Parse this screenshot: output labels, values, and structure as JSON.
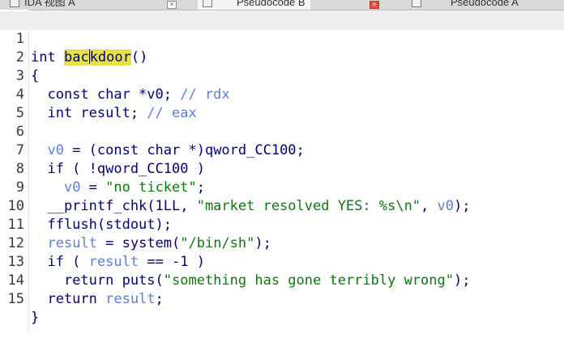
{
  "tabs": [
    {
      "label": "IDA 视图 A",
      "close": "×"
    },
    {
      "label": "Pseudocode B",
      "close": "×"
    },
    {
      "label": "Pseudocode A",
      "close": "×"
    }
  ],
  "code": {
    "line_numbers": [
      "1",
      "2",
      "3",
      "4",
      "5",
      "6",
      "7",
      "8",
      "9",
      "10",
      "11",
      "12",
      "13",
      "14",
      "15"
    ],
    "l1": {
      "t1": "int ",
      "fn_a": "bac",
      "fn_b": "kdoor",
      "t2": "()"
    },
    "l2": {
      "t1": "{"
    },
    "l3": {
      "t1": "  const char *v0; ",
      "c": "// rdx"
    },
    "l4": {
      "t1": "  int result; ",
      "c": "// eax"
    },
    "l5": {
      "t1": ""
    },
    "l6": {
      "v": "v0",
      "t1": " = (const char *)qword_CC100;"
    },
    "l7": {
      "t1": "  if ( !qword_CC100 )"
    },
    "l8": {
      "v": "v0",
      "t1": " = ",
      "s": "\"no ticket\"",
      "t2": ";"
    },
    "l9": {
      "t1": "  __printf_chk(1LL, ",
      "s": "\"market resolved YES: %s\\n\"",
      "t2": ", ",
      "v": "v0",
      "t3": ");"
    },
    "l10": {
      "t1": "  fflush(stdout);"
    },
    "l11": {
      "v": "result",
      "t1": " = system(",
      "s": "\"/bin/sh\"",
      "t2": ");"
    },
    "l12": {
      "t1": "  if ( ",
      "v": "result",
      "t2": " == -1 )"
    },
    "l13": {
      "t1": "    return puts(",
      "s": "\"something has gone terribly wrong\"",
      "t2": ");"
    },
    "l14": {
      "t1": "  return ",
      "v": "result",
      "t2": ";"
    },
    "l15": {
      "t1": "}"
    }
  }
}
